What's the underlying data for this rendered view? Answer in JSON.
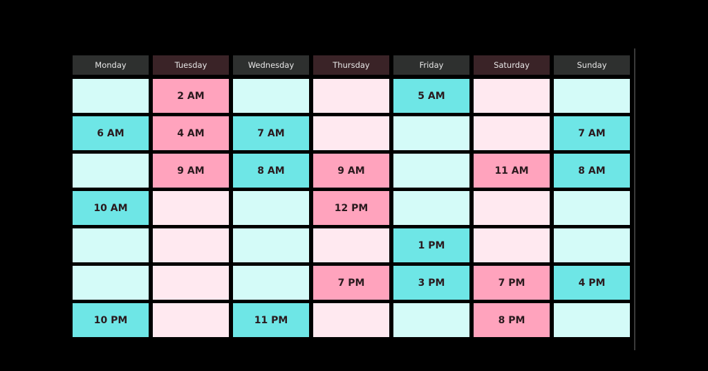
{
  "colors": {
    "teal_header": "#2e302f",
    "pink_header": "#3a2327",
    "teal_active": "#6ee6e6",
    "teal_empty": "#d4fbf8",
    "pink_active": "#ffa3bd",
    "pink_empty": "#ffe9f0"
  },
  "days": [
    {
      "name": "Monday",
      "theme": "teal",
      "slots": [
        "",
        "6 AM",
        "",
        "10 AM",
        "",
        "",
        "10 PM"
      ]
    },
    {
      "name": "Tuesday",
      "theme": "pink",
      "slots": [
        "2 AM",
        "4 AM",
        "9 AM",
        "",
        "",
        "",
        ""
      ]
    },
    {
      "name": "Wednesday",
      "theme": "teal",
      "slots": [
        "",
        "7 AM",
        "8 AM",
        "",
        "",
        "",
        "11 PM"
      ]
    },
    {
      "name": "Thursday",
      "theme": "pink",
      "slots": [
        "",
        "",
        "9 AM",
        "12 PM",
        "",
        "7 PM",
        ""
      ]
    },
    {
      "name": "Friday",
      "theme": "teal",
      "slots": [
        "5 AM",
        "",
        "",
        "",
        "1 PM",
        "3 PM",
        ""
      ]
    },
    {
      "name": "Saturday",
      "theme": "pink",
      "slots": [
        "",
        "",
        "11 AM",
        "",
        "",
        "7 PM",
        "8 PM"
      ]
    },
    {
      "name": "Sunday",
      "theme": "teal",
      "slots": [
        "",
        "7 AM",
        "8 AM",
        "",
        "",
        "4 PM",
        ""
      ]
    }
  ]
}
